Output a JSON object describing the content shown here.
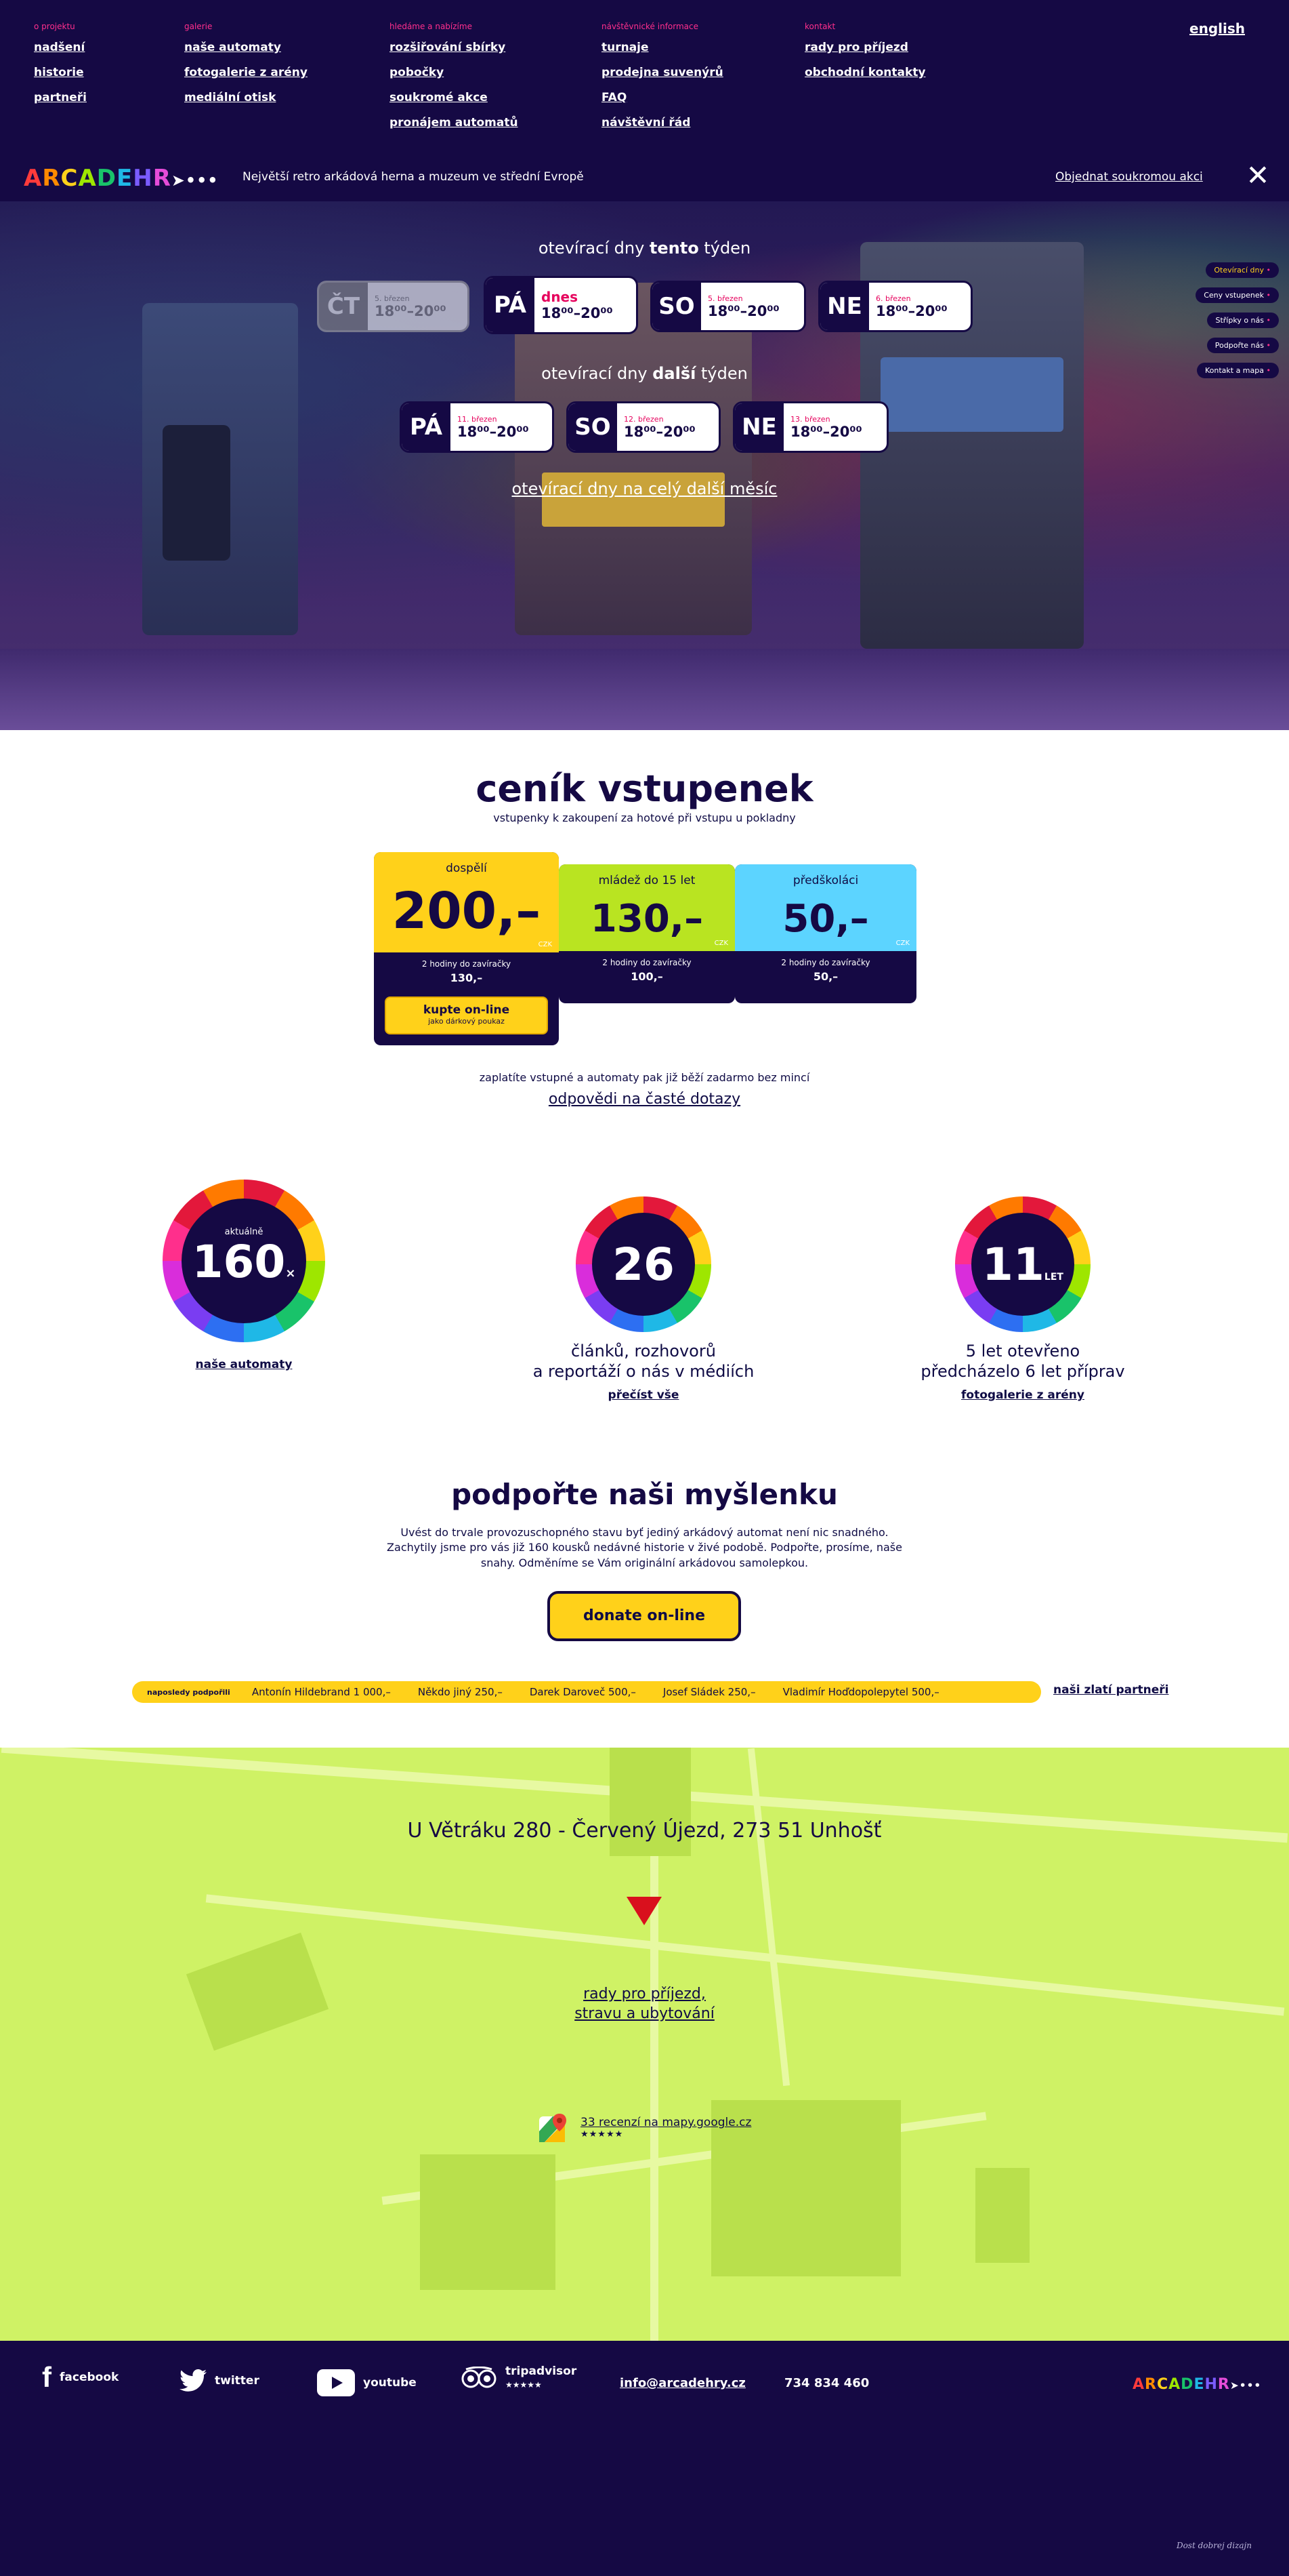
{
  "nav": {
    "columns": [
      {
        "caption": "o projektu",
        "links": [
          "nadšení",
          "historie",
          "partneři"
        ]
      },
      {
        "caption": "galerie",
        "links": [
          "naše automaty",
          "fotogalerie z arény",
          "mediální otisk"
        ]
      },
      {
        "caption": "hledáme a nabízíme",
        "links": [
          "rozšiřování sbírky",
          "pobočky",
          "soukromé akce",
          "pronájem automatů"
        ]
      },
      {
        "caption": "návštěvnické informace",
        "links": [
          "turnaje",
          "prodejna suvenýrů",
          "FAQ",
          "návštěvní řád"
        ]
      },
      {
        "caption": "kontakt",
        "links": [
          "rady pro příjezd",
          "obchodní kontakty"
        ]
      }
    ],
    "language": "english"
  },
  "logobar": {
    "logo_letters": [
      "A",
      "R",
      "C",
      "A",
      "D",
      "E",
      "H",
      "R"
    ],
    "logo_colors": [
      "#ff3b3b",
      "#ff8a00",
      "#ffd11a",
      "#9ee600",
      "#19c36a",
      "#1fb8e6",
      "#7a5cff",
      "#e64cd9"
    ],
    "tagline": "Největší retro arkádová herna a muzeum ve střední Evropě",
    "private_event": "Objednat soukromou akci",
    "close_icon": "close-icon"
  },
  "hero": {
    "this_week_prefix": "otevírací dny ",
    "this_week_bold": "tento",
    "this_week_suffix": " týden",
    "next_week_prefix": "otevírací dny ",
    "next_week_bold": "další",
    "next_week_suffix": " týden",
    "this_week_days": [
      {
        "day": "ČT",
        "date": "5. březen",
        "time": "18⁰⁰–20⁰⁰",
        "state": "past"
      },
      {
        "day": "PÁ",
        "date": "dnes",
        "time": "18⁰⁰–20⁰⁰",
        "state": "today"
      },
      {
        "day": "SO",
        "date": "5. březen",
        "time": "18⁰⁰–20⁰⁰",
        "state": "future"
      },
      {
        "day": "NE",
        "date": "6. březen",
        "time": "18⁰⁰–20⁰⁰",
        "state": "future"
      }
    ],
    "next_week_days": [
      {
        "day": "PÁ",
        "date": "11. březen",
        "time": "18⁰⁰–20⁰⁰"
      },
      {
        "day": "SO",
        "date": "12. březen",
        "time": "18⁰⁰–20⁰⁰"
      },
      {
        "day": "NE",
        "date": "13. březen",
        "time": "18⁰⁰–20⁰⁰"
      }
    ],
    "month_link": "otevírací dny na celý další měsíc",
    "side_nav": [
      "Otevírací dny",
      "Ceny vstupenek",
      "Střípky o nás",
      "Podpořte nás",
      "Kontakt a mapa"
    ]
  },
  "pricing": {
    "title": "ceník vstupenek",
    "subtitle": "vstupenky k zakoupení za hotové při vstupu u pokladny",
    "currency": "CZK",
    "tickets": [
      {
        "label": "dospělí",
        "price": "200,–",
        "late_label": "2 hodiny do zavíračky",
        "late_price": "130,–",
        "color": "#ffd11a"
      },
      {
        "label": "mládež do 15 let",
        "price": "130,–",
        "late_label": "2 hodiny do zavíračky",
        "late_price": "100,–",
        "color": "#b9e421"
      },
      {
        "label": "předškoláci",
        "price": "50,–",
        "late_label": "2 hodiny do zavíračky",
        "late_price": "50,–",
        "color": "#5cd4ff"
      }
    ],
    "buy_label": "kupte on-line",
    "buy_sub": "jako dárkový poukaz",
    "note": "zaplatíte vstupné a automaty pak již běží zadarmo bez mincí",
    "faq_link": "odpovědi na časté dotazy"
  },
  "stats": [
    {
      "small_top": "aktuálně",
      "number": "160",
      "suffix": "×",
      "text_1": "",
      "text_2": "",
      "link": "naše automaty"
    },
    {
      "small_top": "",
      "number": "26",
      "suffix": "",
      "text_1": "článků, rozhovorů",
      "text_2": "a reportáží o nás v médiích",
      "link": "přečíst vše"
    },
    {
      "small_top": "",
      "number": "11",
      "suffix": "LET",
      "text_1": "5 let otevřeno",
      "text_2": "předcházelo 6 let příprav",
      "link": "fotogalerie z arény"
    }
  ],
  "support": {
    "title": "podpořte naši myšlenku",
    "text": "Uvést do trvale provozuschopného stavu byť jediný arkádový automat není nic snadného. Zachytily jsme pro vás již 160 kousků nedávné historie v živé podobě. Podpořte, prosíme, naše snahy. Odměníme se Vám originální arkádovou samolepkou.",
    "donate": "donate on-line",
    "donors_caption": "naposledy podpořili",
    "donors": [
      "Antonín Hildebrand 1 000,–",
      "Někdo jiný 250,–",
      "Darek Daroveč 500,–",
      "Josef Sládek 250,–",
      "Vladimír Hoďdopolepytel 500,–"
    ],
    "partners_link": "naši zlatí partneři"
  },
  "map": {
    "address": "U Větráku 280 - Červený Újezd, 273 51  Unhošť",
    "directions_1": "rady pro příjezd,",
    "directions_2": "stravu a ubytování",
    "reviews": "33 recenzí na mapy.google.cz",
    "stars": "★★★★★"
  },
  "footer": {
    "facebook": "facebook",
    "twitter": "twitter",
    "youtube": "youtube",
    "tripadvisor": "tripadvisor",
    "trip_stars": "★★★★★",
    "email": "info@arcadehry.cz",
    "phone": "734 834 460",
    "credit": "Dost dobrej dizajn"
  }
}
